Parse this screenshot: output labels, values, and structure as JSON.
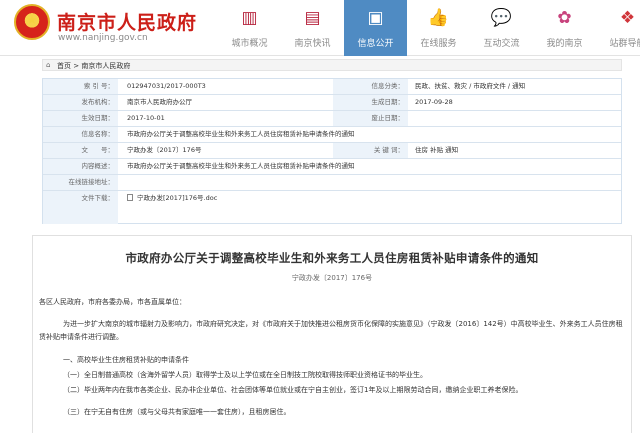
{
  "header": {
    "site_title": "南京市人民政府",
    "site_url": "www.nanjing.gov.cn",
    "nav": [
      {
        "label": "城市概况",
        "icon": "city-building-icon"
      },
      {
        "label": "南京快讯",
        "icon": "news-icon"
      },
      {
        "label": "信息公开",
        "icon": "info-document-icon",
        "active": true
      },
      {
        "label": "在线服务",
        "icon": "thumbs-up-icon"
      },
      {
        "label": "互动交流",
        "icon": "chat-bubbles-icon"
      },
      {
        "label": "我的南京",
        "icon": "flower-icon"
      },
      {
        "label": "站群导航",
        "icon": "compass-icon"
      }
    ]
  },
  "breadcrumb": "首页 > 南京市人民政府",
  "info_table": {
    "index_label": "索 引 号：",
    "index_value": "012947031/2017-000T3",
    "category_label": "信息分类：",
    "category_value": "民政、扶贫、救灾 / 市政府文件 / 通知",
    "publisher_label": "发布机构：",
    "publisher_value": "南京市人民政府办公厅",
    "gen_date_label": "生成日期：",
    "gen_date_value": "2017-09-28",
    "effective_label": "生效日期：",
    "effective_value": "2017-10-01",
    "expire_label": "废止日期：",
    "expire_value": "",
    "name_label": "信息名称：",
    "name_value": "市政府办公厅关于调整高校毕业生和外来务工人员住房租赁补贴申请条件的通知",
    "doc_no_label": "文　　号：",
    "doc_no_value": "宁政办发〔2017〕176号",
    "keywords_label": "关 键 词：",
    "keywords_value": "住房 补贴 通知",
    "summary_label": "内容概述：",
    "summary_value": "市政府办公厅关于调整高校毕业生和外来务工人员住房租赁补贴申请条件的通知",
    "online_label": "在线链接地址：",
    "online_value": "",
    "attachment_label": "文件下载：",
    "attachment_value": "宁政办发[2017]176号.doc"
  },
  "article": {
    "title": "市政府办公厅关于调整高校毕业生和外来务工人员住房租赁补贴申请条件的通知",
    "doc_no": "宁政办发〔2017〕176号",
    "salutation": "各区人民政府，市府各委办局，市各直属单位：",
    "para1": "为进一步扩大南京的城市辐射力及影响力，市政府研究决定，对《市政府关于加快推进公租房货币化保障的实施意见》（宁政发〔2016〕142号）中高校毕业生、外来务工人员住房租赁补贴申请条件进行调整。",
    "heading1": "一、高校毕业生住房租赁补贴的申请条件",
    "item1": "（一）全日制普通高校（含海外留学人员）取得学士及以上学位或在全日制技工院校取得技师职业资格证书的毕业生。",
    "item2": "（二）毕业两年内在我市各类企业、民办非企业单位、社会团体等单位就业或在宁自主创业，签订1年及以上期限劳动合同，缴纳企业职工养老保险。",
    "item3": "（三）在宁无自有住房（或与父母共有家庭唯一一套住房），且租房居住。"
  }
}
